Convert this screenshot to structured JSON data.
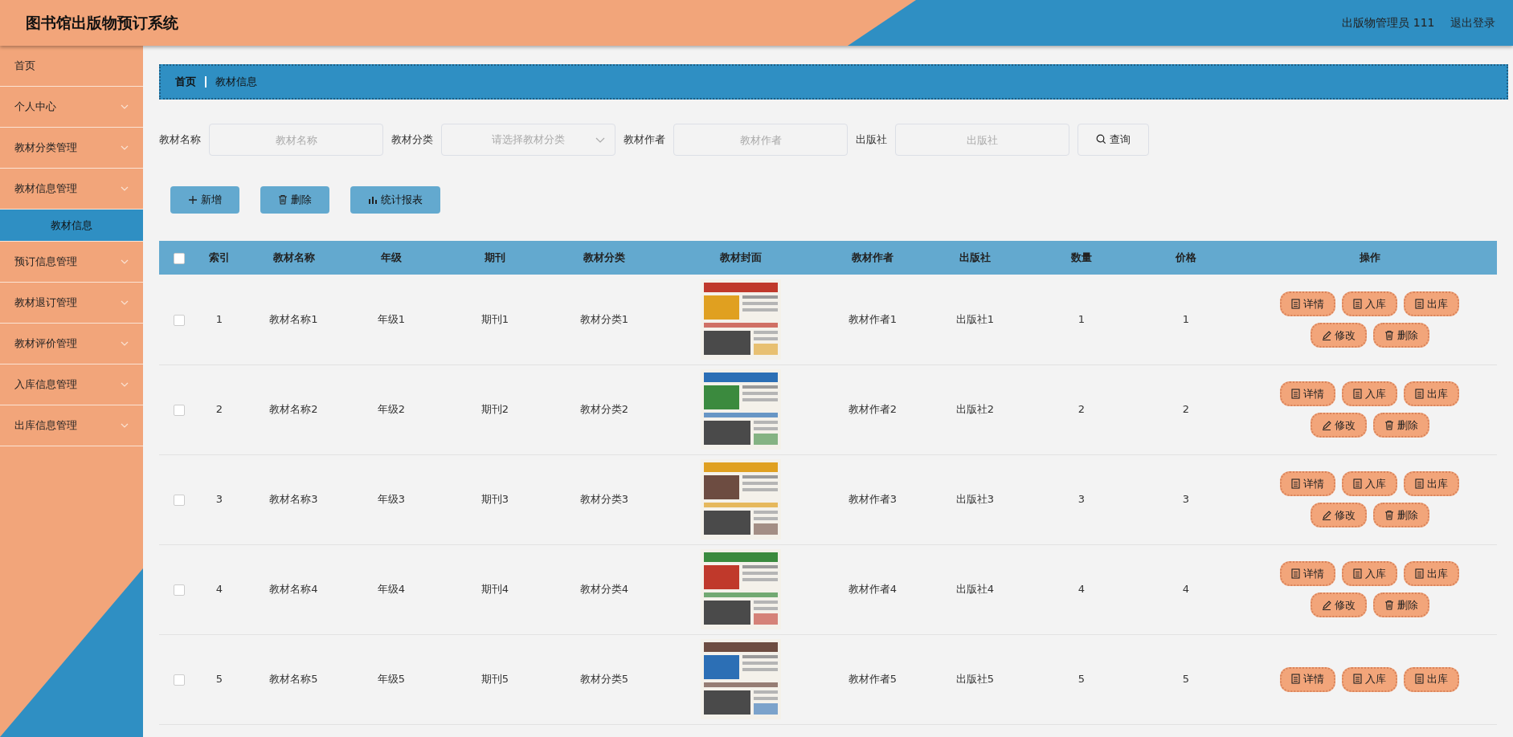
{
  "header": {
    "title": "图书馆出版物预订系统",
    "user": "出版物管理员 111",
    "logout": "退出登录"
  },
  "sidebar": {
    "items": [
      {
        "label": "首页",
        "expandable": false
      },
      {
        "label": "个人中心",
        "expandable": true
      },
      {
        "label": "教材分类管理",
        "expandable": true
      },
      {
        "label": "教材信息管理",
        "expandable": true,
        "children": [
          {
            "label": "教材信息",
            "selected": true
          }
        ]
      },
      {
        "label": "预订信息管理",
        "expandable": true
      },
      {
        "label": "教材退订管理",
        "expandable": true
      },
      {
        "label": "教材评价管理",
        "expandable": true
      },
      {
        "label": "入库信息管理",
        "expandable": true
      },
      {
        "label": "出库信息管理",
        "expandable": true
      }
    ]
  },
  "breadcrumb": [
    {
      "label": "首页",
      "kind": "home"
    },
    {
      "label": "教材信息",
      "kind": "current"
    }
  ],
  "search": {
    "fields": [
      {
        "label": "教材名称",
        "placeholder": "教材名称",
        "kind": "input"
      },
      {
        "label": "教材分类",
        "placeholder": "请选择教材分类",
        "kind": "select"
      },
      {
        "label": "教材作者",
        "placeholder": "教材作者",
        "kind": "input"
      },
      {
        "label": "出版社",
        "placeholder": "出版社",
        "kind": "input"
      }
    ],
    "button": "查询"
  },
  "toolbar": [
    {
      "label": "新增",
      "kind": "add"
    },
    {
      "label": "删除",
      "kind": "delete"
    },
    {
      "label": "统计报表",
      "kind": "report"
    }
  ],
  "table": {
    "select_all": {
      "checked": false
    },
    "columns": [
      {
        "label": "索引",
        "kind": "text"
      },
      {
        "label": "教材名称",
        "kind": "text"
      },
      {
        "label": "年级",
        "kind": "text"
      },
      {
        "label": "期刊",
        "kind": "text"
      },
      {
        "label": "教材分类",
        "kind": "text"
      },
      {
        "label": "教材封面"
      },
      {
        "label": "教材作者",
        "kind": "text"
      },
      {
        "label": "出版社",
        "kind": "text"
      },
      {
        "label": "数量",
        "kind": "text"
      },
      {
        "label": "价格",
        "kind": "text"
      },
      {
        "label": "操作",
        "kind": "actions"
      }
    ],
    "rows": [
      {
        "checked": false,
        "values": [
          "1",
          "教材名称1",
          "年级1",
          "期刊1",
          "教材分类1",
          "教材作者1",
          "出版社1",
          "1",
          "1"
        ],
        "cover": {
          "kind": "picture"
        },
        "actions": [
          {
            "label": "详情",
            "kind": "doc"
          },
          {
            "label": "入库",
            "kind": "doc"
          },
          {
            "label": "出库",
            "kind": "doc"
          },
          {
            "label": "修改",
            "kind": "edit"
          },
          {
            "label": "删除",
            "kind": "delete"
          }
        ]
      },
      {
        "checked": false,
        "values": [
          "2",
          "教材名称2",
          "年级2",
          "期刊2",
          "教材分类2",
          "教材作者2",
          "出版社2",
          "2",
          "2"
        ],
        "cover": {
          "kind": "picture"
        },
        "actions": [
          {
            "label": "详情",
            "kind": "doc"
          },
          {
            "label": "入库",
            "kind": "doc"
          },
          {
            "label": "出库",
            "kind": "doc"
          },
          {
            "label": "修改",
            "kind": "edit"
          },
          {
            "label": "删除",
            "kind": "delete"
          }
        ]
      },
      {
        "checked": false,
        "values": [
          "3",
          "教材名称3",
          "年级3",
          "期刊3",
          "教材分类3",
          "教材作者3",
          "出版社3",
          "3",
          "3"
        ],
        "cover": {
          "kind": "picture"
        },
        "actions": [
          {
            "label": "详情",
            "kind": "doc"
          },
          {
            "label": "入库",
            "kind": "doc"
          },
          {
            "label": "出库",
            "kind": "doc"
          },
          {
            "label": "修改",
            "kind": "edit"
          },
          {
            "label": "删除",
            "kind": "delete"
          }
        ]
      },
      {
        "checked": false,
        "values": [
          "4",
          "教材名称4",
          "年级4",
          "期刊4",
          "教材分类4",
          "教材作者4",
          "出版社4",
          "4",
          "4"
        ],
        "cover": {
          "kind": "picture"
        },
        "actions": [
          {
            "label": "详情",
            "kind": "doc"
          },
          {
            "label": "入库",
            "kind": "doc"
          },
          {
            "label": "出库",
            "kind": "doc"
          },
          {
            "label": "修改",
            "kind": "edit"
          },
          {
            "label": "删除",
            "kind": "delete"
          }
        ]
      },
      {
        "checked": false,
        "values": [
          "5",
          "教材名称5",
          "年级5",
          "期刊5",
          "教材分类5",
          "教材作者5",
          "出版社5",
          "5",
          "5"
        ],
        "cover": {
          "kind": "picture"
        },
        "actions": [
          {
            "label": "详情",
            "kind": "doc"
          },
          {
            "label": "入库",
            "kind": "doc"
          },
          {
            "label": "出库",
            "kind": "doc"
          }
        ]
      }
    ]
  }
}
